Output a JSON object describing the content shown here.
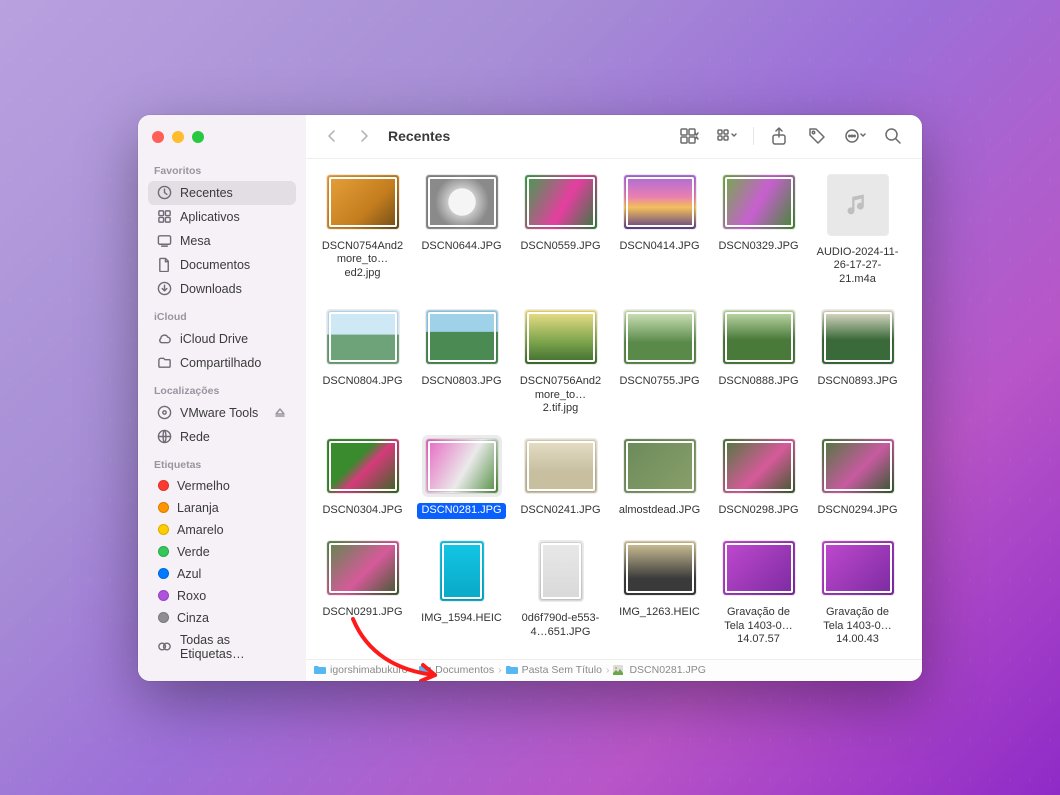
{
  "window": {
    "title": "Recentes"
  },
  "sidebar": {
    "sections": [
      {
        "heading": "Favoritos",
        "items": [
          {
            "icon": "clock",
            "label": "Recentes",
            "active": true
          },
          {
            "icon": "apps",
            "label": "Aplicativos"
          },
          {
            "icon": "desktop",
            "label": "Mesa"
          },
          {
            "icon": "doc",
            "label": "Documentos"
          },
          {
            "icon": "download",
            "label": "Downloads"
          }
        ]
      },
      {
        "heading": "iCloud",
        "items": [
          {
            "icon": "cloud",
            "label": "iCloud Drive"
          },
          {
            "icon": "shared",
            "label": "Compartilhado"
          }
        ]
      },
      {
        "heading": "Localizações",
        "items": [
          {
            "icon": "disc",
            "label": "VMware Tools",
            "eject": true
          },
          {
            "icon": "globe",
            "label": "Rede"
          }
        ]
      },
      {
        "heading": "Etiquetas",
        "items": [
          {
            "icon": "tag",
            "color": "#ff3b30",
            "label": "Vermelho"
          },
          {
            "icon": "tag",
            "color": "#ff9500",
            "label": "Laranja"
          },
          {
            "icon": "tag",
            "color": "#ffcc00",
            "label": "Amarelo"
          },
          {
            "icon": "tag",
            "color": "#34c759",
            "label": "Verde"
          },
          {
            "icon": "tag",
            "color": "#007aff",
            "label": "Azul"
          },
          {
            "icon": "tag",
            "color": "#af52de",
            "label": "Roxo"
          },
          {
            "icon": "tag",
            "color": "#8e8e93",
            "label": "Cinza"
          },
          {
            "icon": "alltags",
            "label": "Todas as Etiquetas…"
          }
        ]
      }
    ]
  },
  "files": [
    {
      "name": "DSCN0754And2more_to…ed2.jpg",
      "kind": "photo",
      "bg": "linear-gradient(135deg,#e7a13a,#c47d1e 60%,#6b4a17)"
    },
    {
      "name": "DSCN0644.JPG",
      "kind": "photo",
      "bg": "radial-gradient(circle at 50% 50%, #f5f5f5 30%, #c9c9c9 31%, #8a8a8a 60%)"
    },
    {
      "name": "DSCN0559.JPG",
      "kind": "photo",
      "bg": "linear-gradient(120deg,#3aa24a,#e63ea0 55%,#2e7d3b)"
    },
    {
      "name": "DSCN0414.JPG",
      "kind": "photo",
      "bg": "linear-gradient(180deg,#a86bd9 0%,#e97fb1 40%,#f3c05a 60%,#5a3c86 100%)"
    },
    {
      "name": "DSCN0329.JPG",
      "kind": "photo",
      "bg": "linear-gradient(120deg,#6fae44,#c85fd0 50%,#3e8a2e)"
    },
    {
      "name": "AUDIO-2024-11-26-17-27-21.m4a",
      "kind": "audio"
    },
    {
      "name": "DSCN0804.JPG",
      "kind": "photo",
      "bg": "linear-gradient(180deg,#cfe8f5 45%,#6ea37a 46%)"
    },
    {
      "name": "DSCN0803.JPG",
      "kind": "photo",
      "bg": "linear-gradient(180deg,#9fd1e9 40%,#4b8a53 41%)"
    },
    {
      "name": "DSCN0756And2more_to…2.tif.jpg",
      "kind": "photo",
      "bg": "linear-gradient(180deg,#f2e28a 0%,#7aa34a 60%,#3e6a2e)"
    },
    {
      "name": "DSCN0755.JPG",
      "kind": "photo",
      "bg": "linear-gradient(180deg,#d7e8c0 0%,#5a8a4a 60%)"
    },
    {
      "name": "DSCN0888.JPG",
      "kind": "photo",
      "bg": "linear-gradient(180deg,#c8dfb0 0%,#4a7a3a 55%)"
    },
    {
      "name": "DSCN0893.JPG",
      "kind": "photo",
      "bg": "linear-gradient(180deg,#e8e2d0 0%,#3a6a3a 55%)"
    },
    {
      "name": "DSCN0304.JPG",
      "kind": "photo",
      "bg": "linear-gradient(135deg,#3a8a2e 40%,#d63a7a 55%,#2e6a1e)"
    },
    {
      "name": "DSCN0281.JPG",
      "kind": "photo",
      "bg": "linear-gradient(120deg,#e864c1,#eaeaea 55%,#4a8a3a)",
      "selected": true
    },
    {
      "name": "DSCN0241.JPG",
      "kind": "photo",
      "bg": "linear-gradient(180deg,#e6e0c8 0%,#c7bfa0 60%)"
    },
    {
      "name": "almostdead.JPG",
      "kind": "photo",
      "bg": "linear-gradient(135deg,#6a8a5a,#8aa06a)"
    },
    {
      "name": "DSCN0298.JPG",
      "kind": "photo",
      "bg": "linear-gradient(135deg,#4a7a3a,#d65a9a 55%,#3a5a2a)"
    },
    {
      "name": "DSCN0294.JPG",
      "kind": "photo",
      "bg": "linear-gradient(135deg,#4a7a3a,#c85aa0 55%,#2e5a2a)"
    },
    {
      "name": "DSCN0291.JPG",
      "kind": "photo",
      "bg": "linear-gradient(135deg,#5a8a4a,#d65a9a 55%,#3a5a2a)"
    },
    {
      "name": "IMG_1594.HEIC",
      "kind": "portrait",
      "bg": "linear-gradient(180deg,#13c7e6,#0aa7c6)"
    },
    {
      "name": "0d6f790d-e553-4…651.JPG",
      "kind": "portrait",
      "bg": "linear-gradient(180deg,#e9e9e9,#d8d8d8)"
    },
    {
      "name": "IMG_1263.HEIC",
      "kind": "photo",
      "bg": "linear-gradient(180deg,#d6c89a 0%,#3a3a3a 70%)"
    },
    {
      "name": "Gravação de Tela 1403-0…14.07.57",
      "kind": "photo",
      "bg": "linear-gradient(135deg,#c24ad0 0%,#7a2aa0 100%)"
    },
    {
      "name": "Gravação de Tela 1403-0…14.00.43",
      "kind": "photo",
      "bg": "linear-gradient(135deg,#c24ad0 0%,#7a2aa0 100%)"
    },
    {
      "name": "",
      "kind": "photo",
      "bg": "linear-gradient(135deg,#c24ad0 0%,#7a2aa0 100%)"
    },
    {
      "name": "",
      "kind": "photo",
      "bg": "linear-gradient(135deg,#c24ad0 0%,#7a2aa0 100%)"
    },
    {
      "name": "",
      "kind": "photo",
      "bg": "linear-gradient(135deg,#e0d5c0 0%,#c2aa8a 100%)"
    },
    {
      "name": "",
      "kind": "photo",
      "bg": "linear-gradient(135deg,#c24ad0 0%,#7a2aa0 100%)"
    },
    {
      "name": "",
      "kind": "photo",
      "bg": "linear-gradient(135deg,#c24ad0 0%,#7a2aa0 100%)"
    },
    {
      "name": "",
      "kind": "photo",
      "bg": "linear-gradient(135deg,#c24ad0 0%,#7a2aa0 100%)"
    }
  ],
  "pathbar": [
    {
      "icon": "folder",
      "label": "igorshimabukuro"
    },
    {
      "icon": "folder",
      "label": "Documentos"
    },
    {
      "icon": "folder",
      "label": "Pasta Sem Título"
    },
    {
      "icon": "jpg",
      "label": "DSCN0281.JPG"
    }
  ]
}
